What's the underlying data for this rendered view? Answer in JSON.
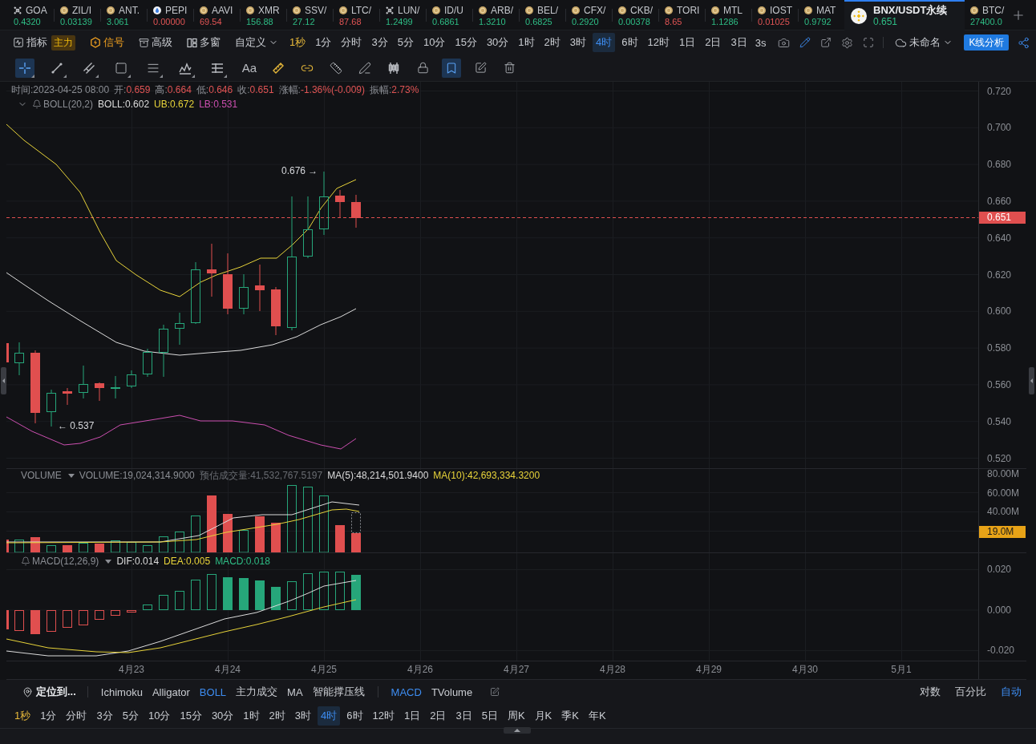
{
  "tickers": [
    {
      "symbol": "GOA",
      "price": "0.4320",
      "color": "#2ebd85",
      "selected": false
    },
    {
      "symbol": "ZIL/I",
      "price": "0.03139",
      "color": "#2ebd85",
      "selected": false
    },
    {
      "symbol": "ANT.",
      "price": "3.061",
      "color": "#2ebd85",
      "selected": false
    },
    {
      "symbol": "PEPI",
      "price": "0.00000",
      "color": "#e05454",
      "selected": false
    },
    {
      "symbol": "AAVI",
      "price": "69.54",
      "color": "#e05454",
      "selected": false
    },
    {
      "symbol": "XMR",
      "price": "156.88",
      "color": "#2ebd85",
      "selected": false
    },
    {
      "symbol": "SSV/",
      "price": "27.12",
      "color": "#2ebd85",
      "selected": false
    },
    {
      "symbol": "LTC/",
      "price": "87.68",
      "color": "#e05454",
      "selected": false
    },
    {
      "symbol": "LUN/",
      "price": "1.2499",
      "color": "#2ebd85",
      "selected": false
    },
    {
      "symbol": "ID/U",
      "price": "0.6861",
      "color": "#2ebd85",
      "selected": false
    },
    {
      "symbol": "ARB/",
      "price": "1.3210",
      "color": "#2ebd85",
      "selected": false
    },
    {
      "symbol": "BEL/",
      "price": "0.6825",
      "color": "#2ebd85",
      "selected": false
    },
    {
      "symbol": "CFX/",
      "price": "0.2920",
      "color": "#2ebd85",
      "selected": false
    },
    {
      "symbol": "CKB/",
      "price": "0.00378",
      "color": "#2ebd85",
      "selected": false
    },
    {
      "symbol": "TORI",
      "price": "8.65",
      "color": "#e05454",
      "selected": false
    },
    {
      "symbol": "MTL",
      "price": "1.1286",
      "color": "#2ebd85",
      "selected": false
    },
    {
      "symbol": "IOST",
      "price": "0.01025",
      "color": "#e05454",
      "selected": false
    },
    {
      "symbol": "MAT",
      "price": "0.9792",
      "color": "#2ebd85",
      "selected": false
    },
    {
      "symbol": "BNX/USDT永续",
      "price": "0.651",
      "color": "#2ebd85",
      "selected": true
    },
    {
      "symbol": "BTC/",
      "price": "27400.0",
      "color": "#2ebd85",
      "selected": false
    }
  ],
  "toolbar": {
    "indicator": {
      "label": "指标",
      "tag": "主力"
    },
    "signal": {
      "label": "信号",
      "on": true
    },
    "advanced": "高级",
    "multi_window": "多窗",
    "custom": "自定义",
    "intervals": [
      {
        "label": "1秒",
        "selected": false,
        "highlighted": true
      },
      {
        "label": "1分",
        "selected": false,
        "highlighted": false
      },
      {
        "label": "分时",
        "selected": false,
        "highlighted": false
      },
      {
        "label": "3分",
        "selected": false,
        "highlighted": false
      },
      {
        "label": "5分",
        "selected": false,
        "highlighted": false
      },
      {
        "label": "10分",
        "selected": false,
        "highlighted": false
      },
      {
        "label": "15分",
        "selected": false,
        "highlighted": false
      },
      {
        "label": "30分",
        "selected": false,
        "highlighted": false
      },
      {
        "label": "1时",
        "selected": false,
        "highlighted": false
      },
      {
        "label": "2时",
        "selected": false,
        "highlighted": false
      },
      {
        "label": "3时",
        "selected": false,
        "highlighted": false
      },
      {
        "label": "4时",
        "selected": true,
        "highlighted": false
      },
      {
        "label": "6时",
        "selected": false,
        "highlighted": false
      },
      {
        "label": "12时",
        "selected": false,
        "highlighted": false
      },
      {
        "label": "1日",
        "selected": false,
        "highlighted": false
      },
      {
        "label": "2日",
        "selected": false,
        "highlighted": false
      },
      {
        "label": "3日",
        "selected": false,
        "highlighted": false
      }
    ],
    "refresh": "3s",
    "layout_name": "未命名",
    "analysis_button": "K线分析"
  },
  "drawing_tools": [
    {
      "selected": true,
      "on": false,
      "menu": true
    },
    {
      "selected": false,
      "on": false,
      "menu": true
    },
    {
      "selected": false,
      "on": false,
      "menu": true
    },
    {
      "selected": false,
      "on": false,
      "menu": true
    },
    {
      "selected": false,
      "on": false,
      "menu": true
    },
    {
      "selected": false,
      "on": false,
      "menu": true
    },
    {
      "selected": false,
      "on": false,
      "menu": true
    },
    {
      "label": "Aa",
      "selected": false,
      "on": false,
      "menu": false
    },
    {
      "selected": false,
      "on": true,
      "menu": false
    },
    {
      "selected": false,
      "on": true,
      "menu": false
    },
    {
      "selected": false,
      "on": false,
      "menu": false
    },
    {
      "selected": false,
      "on": false,
      "menu": false
    },
    {
      "selected": false,
      "on": false,
      "menu": false
    },
    {
      "selected": false,
      "on": false,
      "menu": false
    },
    {
      "selected": true,
      "on": false,
      "menu": false
    },
    {
      "selected": false,
      "on": false,
      "menu": false
    },
    {
      "selected": false,
      "on": false,
      "menu": false
    }
  ],
  "chart": {
    "ohlc": {
      "time": "时间:2023-04-25 08:00",
      "fields": [
        {
          "label": "开:",
          "value": "0.659"
        },
        {
          "label": "高:",
          "value": "0.664"
        },
        {
          "label": "低:",
          "value": "0.646"
        },
        {
          "label": "收:",
          "value": "0.651"
        },
        {
          "label": "涨幅:",
          "value": "-1.36%(-0.009)"
        },
        {
          "label": "振幅:",
          "value": "2.73%"
        }
      ]
    },
    "boll": {
      "name": "BOLL(20,2)",
      "values": [
        {
          "text": "BOLL:0.602",
          "color": "#dcdcdc"
        },
        {
          "text": "UB:0.672",
          "color": "#e8d43a"
        },
        {
          "text": "LB:0.531",
          "color": "#cc4fb0"
        }
      ]
    },
    "high_marker": "0.676 →",
    "low_marker": "← 0.537",
    "price_ticks": [
      "0.720",
      "0.700",
      "0.680",
      "0.660",
      "0.640",
      "0.620",
      "0.600",
      "0.580",
      "0.560",
      "0.540",
      "0.520"
    ],
    "current_price": "0.651",
    "volume": {
      "name": "VOLUME",
      "values": [
        {
          "text": "VOLUME:19,024,314.9000",
          "color": "#8b8e94"
        },
        {
          "text": "预估成交量:41,532,767.5197",
          "color": "#686b71"
        },
        {
          "text": "MA(5):48,214,501.9400",
          "color": "#dcdcdc"
        },
        {
          "text": "MA(10):42,693,334.3200",
          "color": "#e8d43a"
        }
      ],
      "ticks": [
        "80.00M",
        "60.00M",
        "40.00M"
      ],
      "current": "19.0M"
    },
    "macd": {
      "name": "MACD(12,26,9)",
      "values": [
        {
          "text": "DIF:0.014",
          "color": "#dcdcdc"
        },
        {
          "text": "DEA:0.005",
          "color": "#e8d43a"
        },
        {
          "text": "MACD:0.018",
          "color": "#2ebd85"
        }
      ],
      "ticks": [
        "0.020",
        "0.000",
        "-0.020"
      ]
    },
    "dates": [
      "4月23",
      "4月24",
      "4月25",
      "4月26",
      "4月27",
      "4月28",
      "4月29",
      "4月30",
      "5月1"
    ]
  },
  "indicator_bar": {
    "locate": "定位到...",
    "main": [
      {
        "label": "Ichimoku",
        "selected": false
      },
      {
        "label": "Alligator",
        "selected": false
      },
      {
        "label": "BOLL",
        "selected": true
      },
      {
        "label": "主力成交",
        "selected": false
      },
      {
        "label": "MA",
        "selected": false
      },
      {
        "label": "智能撑压线",
        "selected": false
      }
    ],
    "sub": [
      {
        "label": "MACD",
        "selected": true
      },
      {
        "label": "TVolume",
        "selected": false
      }
    ],
    "scales": [
      {
        "label": "对数",
        "selected": false
      },
      {
        "label": "百分比",
        "selected": false
      },
      {
        "label": "自动",
        "selected": true
      }
    ]
  },
  "bottom_intervals": [
    {
      "label": "1秒",
      "selected": false,
      "highlighted": true
    },
    {
      "label": "1分",
      "selected": false,
      "highlighted": false
    },
    {
      "label": "分时",
      "selected": false,
      "highlighted": false
    },
    {
      "label": "3分",
      "selected": false,
      "highlighted": false
    },
    {
      "label": "5分",
      "selected": false,
      "highlighted": false
    },
    {
      "label": "10分",
      "selected": false,
      "highlighted": false
    },
    {
      "label": "15分",
      "selected": false,
      "highlighted": false
    },
    {
      "label": "30分",
      "selected": false,
      "highlighted": false
    },
    {
      "label": "1时",
      "selected": false,
      "highlighted": false
    },
    {
      "label": "2时",
      "selected": false,
      "highlighted": false
    },
    {
      "label": "3时",
      "selected": false,
      "highlighted": false
    },
    {
      "label": "4时",
      "selected": true,
      "highlighted": false
    },
    {
      "label": "6时",
      "selected": false,
      "highlighted": false
    },
    {
      "label": "12时",
      "selected": false,
      "highlighted": false
    },
    {
      "label": "1日",
      "selected": false,
      "highlighted": false
    },
    {
      "label": "2日",
      "selected": false,
      "highlighted": false
    },
    {
      "label": "3日",
      "selected": false,
      "highlighted": false
    },
    {
      "label": "5日",
      "selected": false,
      "highlighted": false
    },
    {
      "label": "周K",
      "selected": false,
      "highlighted": false
    },
    {
      "label": "月K",
      "selected": false,
      "highlighted": false
    },
    {
      "label": "季K",
      "selected": false,
      "highlighted": false
    },
    {
      "label": "年K",
      "selected": false,
      "highlighted": false
    }
  ]
}
